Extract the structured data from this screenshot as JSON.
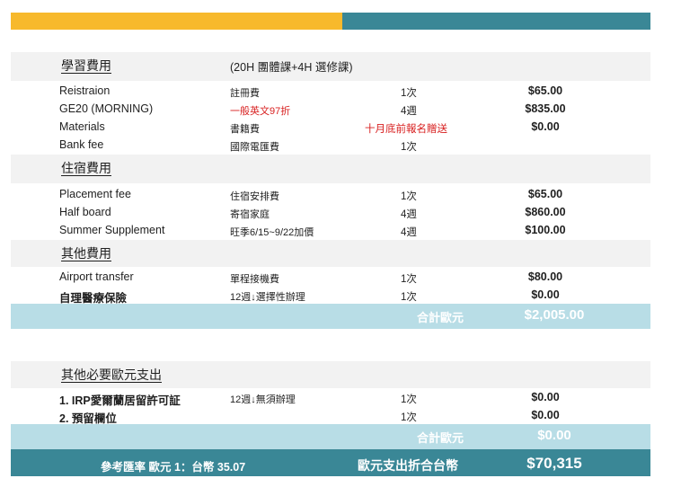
{
  "colors": {
    "accent_yellow": "#f7b92c",
    "accent_teal": "#3a8796",
    "total_bg": "#b8dde6",
    "section_bg": "#f2f2f2",
    "promo_red": "#d82020"
  },
  "tuition": {
    "title": "學習費用",
    "note": "(20H 團體課+4H 選修課)",
    "rows": [
      {
        "name": "Reistraion",
        "desc": "註冊費",
        "qty": "1次",
        "amount": "$65.00"
      },
      {
        "name": "GE20 (MORNING)",
        "desc": "一般英文97折",
        "qty": "4週",
        "amount": "$835.00"
      },
      {
        "name": "Materials",
        "desc": "書籍費",
        "promo": "十月底前報名贈送",
        "amount": "$0.00"
      },
      {
        "name": "Bank fee",
        "desc": "國際電匯費",
        "qty": "1次",
        "amount": ""
      }
    ]
  },
  "accommodation": {
    "title": "住宿費用",
    "rows": [
      {
        "name": "Placement fee",
        "desc": "住宿安排費",
        "qty": "1次",
        "amount": "$65.00"
      },
      {
        "name": "Half board",
        "desc": "寄宿家庭",
        "qty": "4週",
        "amount": "$860.00"
      },
      {
        "name": "Summer Supplement",
        "desc": "旺季6/15~9/22加價",
        "qty": "4週",
        "amount": "$100.00"
      }
    ]
  },
  "other": {
    "title": "其他費用",
    "rows": [
      {
        "name": "Airport transfer",
        "desc": "單程接機費",
        "qty": "1次",
        "amount": "$80.00"
      },
      {
        "name": "自理醫療保險",
        "desc": "12週↓選擇性辦理",
        "qty": "1次",
        "amount": "$0.00"
      }
    ],
    "total_label": "合計歐元",
    "total_value": "$2,005.00"
  },
  "necessary": {
    "title": "其他必要歐元支出",
    "rows": [
      {
        "name": "1. IRP愛爾蘭居留許可証",
        "desc": "12週↓無須辦理",
        "qty": "1次",
        "amount": "$0.00"
      },
      {
        "name": "2. 預留欄位",
        "desc": "",
        "qty": "1次",
        "amount": "$0.00"
      }
    ],
    "total_label": "合計歐元",
    "total_value": "$0.00"
  },
  "footer": {
    "rate": "參考匯率 歐元 1：台幣 35.07",
    "label": "歐元支出折合台幣",
    "value": "$70,315"
  }
}
